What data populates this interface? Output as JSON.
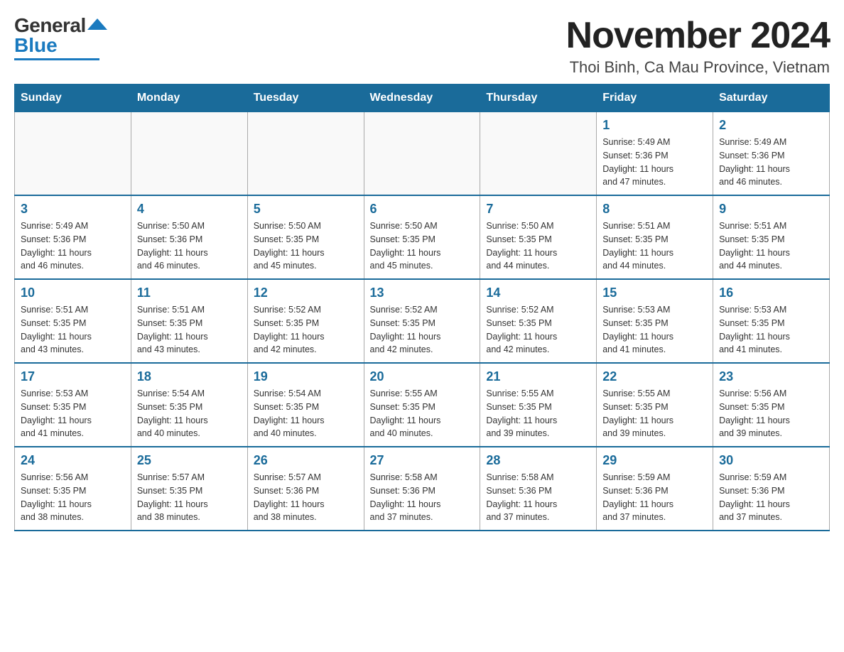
{
  "logo": {
    "general": "General",
    "blue": "Blue"
  },
  "title": "November 2024",
  "location": "Thoi Binh, Ca Mau Province, Vietnam",
  "days_of_week": [
    "Sunday",
    "Monday",
    "Tuesday",
    "Wednesday",
    "Thursday",
    "Friday",
    "Saturday"
  ],
  "weeks": [
    [
      {
        "day": "",
        "info": ""
      },
      {
        "day": "",
        "info": ""
      },
      {
        "day": "",
        "info": ""
      },
      {
        "day": "",
        "info": ""
      },
      {
        "day": "",
        "info": ""
      },
      {
        "day": "1",
        "info": "Sunrise: 5:49 AM\nSunset: 5:36 PM\nDaylight: 11 hours\nand 47 minutes."
      },
      {
        "day": "2",
        "info": "Sunrise: 5:49 AM\nSunset: 5:36 PM\nDaylight: 11 hours\nand 46 minutes."
      }
    ],
    [
      {
        "day": "3",
        "info": "Sunrise: 5:49 AM\nSunset: 5:36 PM\nDaylight: 11 hours\nand 46 minutes."
      },
      {
        "day": "4",
        "info": "Sunrise: 5:50 AM\nSunset: 5:36 PM\nDaylight: 11 hours\nand 46 minutes."
      },
      {
        "day": "5",
        "info": "Sunrise: 5:50 AM\nSunset: 5:35 PM\nDaylight: 11 hours\nand 45 minutes."
      },
      {
        "day": "6",
        "info": "Sunrise: 5:50 AM\nSunset: 5:35 PM\nDaylight: 11 hours\nand 45 minutes."
      },
      {
        "day": "7",
        "info": "Sunrise: 5:50 AM\nSunset: 5:35 PM\nDaylight: 11 hours\nand 44 minutes."
      },
      {
        "day": "8",
        "info": "Sunrise: 5:51 AM\nSunset: 5:35 PM\nDaylight: 11 hours\nand 44 minutes."
      },
      {
        "day": "9",
        "info": "Sunrise: 5:51 AM\nSunset: 5:35 PM\nDaylight: 11 hours\nand 44 minutes."
      }
    ],
    [
      {
        "day": "10",
        "info": "Sunrise: 5:51 AM\nSunset: 5:35 PM\nDaylight: 11 hours\nand 43 minutes."
      },
      {
        "day": "11",
        "info": "Sunrise: 5:51 AM\nSunset: 5:35 PM\nDaylight: 11 hours\nand 43 minutes."
      },
      {
        "day": "12",
        "info": "Sunrise: 5:52 AM\nSunset: 5:35 PM\nDaylight: 11 hours\nand 42 minutes."
      },
      {
        "day": "13",
        "info": "Sunrise: 5:52 AM\nSunset: 5:35 PM\nDaylight: 11 hours\nand 42 minutes."
      },
      {
        "day": "14",
        "info": "Sunrise: 5:52 AM\nSunset: 5:35 PM\nDaylight: 11 hours\nand 42 minutes."
      },
      {
        "day": "15",
        "info": "Sunrise: 5:53 AM\nSunset: 5:35 PM\nDaylight: 11 hours\nand 41 minutes."
      },
      {
        "day": "16",
        "info": "Sunrise: 5:53 AM\nSunset: 5:35 PM\nDaylight: 11 hours\nand 41 minutes."
      }
    ],
    [
      {
        "day": "17",
        "info": "Sunrise: 5:53 AM\nSunset: 5:35 PM\nDaylight: 11 hours\nand 41 minutes."
      },
      {
        "day": "18",
        "info": "Sunrise: 5:54 AM\nSunset: 5:35 PM\nDaylight: 11 hours\nand 40 minutes."
      },
      {
        "day": "19",
        "info": "Sunrise: 5:54 AM\nSunset: 5:35 PM\nDaylight: 11 hours\nand 40 minutes."
      },
      {
        "day": "20",
        "info": "Sunrise: 5:55 AM\nSunset: 5:35 PM\nDaylight: 11 hours\nand 40 minutes."
      },
      {
        "day": "21",
        "info": "Sunrise: 5:55 AM\nSunset: 5:35 PM\nDaylight: 11 hours\nand 39 minutes."
      },
      {
        "day": "22",
        "info": "Sunrise: 5:55 AM\nSunset: 5:35 PM\nDaylight: 11 hours\nand 39 minutes."
      },
      {
        "day": "23",
        "info": "Sunrise: 5:56 AM\nSunset: 5:35 PM\nDaylight: 11 hours\nand 39 minutes."
      }
    ],
    [
      {
        "day": "24",
        "info": "Sunrise: 5:56 AM\nSunset: 5:35 PM\nDaylight: 11 hours\nand 38 minutes."
      },
      {
        "day": "25",
        "info": "Sunrise: 5:57 AM\nSunset: 5:35 PM\nDaylight: 11 hours\nand 38 minutes."
      },
      {
        "day": "26",
        "info": "Sunrise: 5:57 AM\nSunset: 5:36 PM\nDaylight: 11 hours\nand 38 minutes."
      },
      {
        "day": "27",
        "info": "Sunrise: 5:58 AM\nSunset: 5:36 PM\nDaylight: 11 hours\nand 37 minutes."
      },
      {
        "day": "28",
        "info": "Sunrise: 5:58 AM\nSunset: 5:36 PM\nDaylight: 11 hours\nand 37 minutes."
      },
      {
        "day": "29",
        "info": "Sunrise: 5:59 AM\nSunset: 5:36 PM\nDaylight: 11 hours\nand 37 minutes."
      },
      {
        "day": "30",
        "info": "Sunrise: 5:59 AM\nSunset: 5:36 PM\nDaylight: 11 hours\nand 37 minutes."
      }
    ]
  ]
}
